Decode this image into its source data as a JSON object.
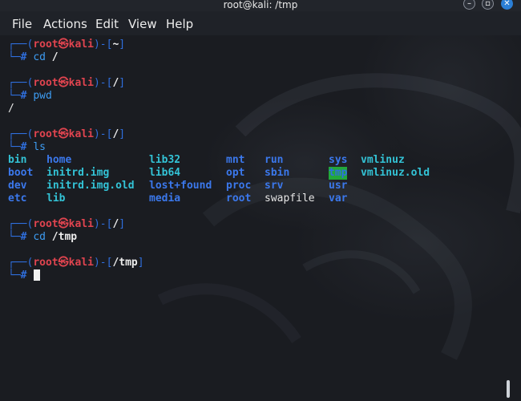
{
  "window": {
    "title": "root@kali: /tmp"
  },
  "menu": [
    "File",
    "Actions",
    "Edit",
    "View",
    "Help"
  ],
  "prompt": {
    "user": "root",
    "at": "㉿",
    "host": "kali"
  },
  "blocks": [
    {
      "path": "~",
      "command": "cd",
      "arg": "/"
    },
    {
      "path": "/",
      "command": "pwd",
      "arg": "",
      "output": "/"
    },
    {
      "path": "/",
      "command": "ls",
      "arg": ""
    },
    {
      "path": "/",
      "command": "cd",
      "arg": "/tmp"
    },
    {
      "path": "/tmp",
      "command": "",
      "arg": ""
    }
  ],
  "ls_rows": [
    [
      "bin",
      "home",
      "lib32",
      "mnt",
      "run",
      "sys",
      "vmlinuz"
    ],
    [
      "boot",
      "initrd.img",
      "lib64",
      "opt",
      "sbin",
      "tmp",
      "vmlinuz.old"
    ],
    [
      "dev",
      "initrd.img.old",
      "lost+found",
      "proc",
      "srv",
      "usr",
      ""
    ],
    [
      "etc",
      "lib",
      "media",
      "root",
      "swapfile",
      "var",
      ""
    ]
  ],
  "colors": {
    "prompt_frame": "#2f6fde",
    "user_host": "#e0444f",
    "directory": "#3b78ec",
    "symlink": "#33c3d6",
    "tmp_highlight": "#22a83a"
  }
}
